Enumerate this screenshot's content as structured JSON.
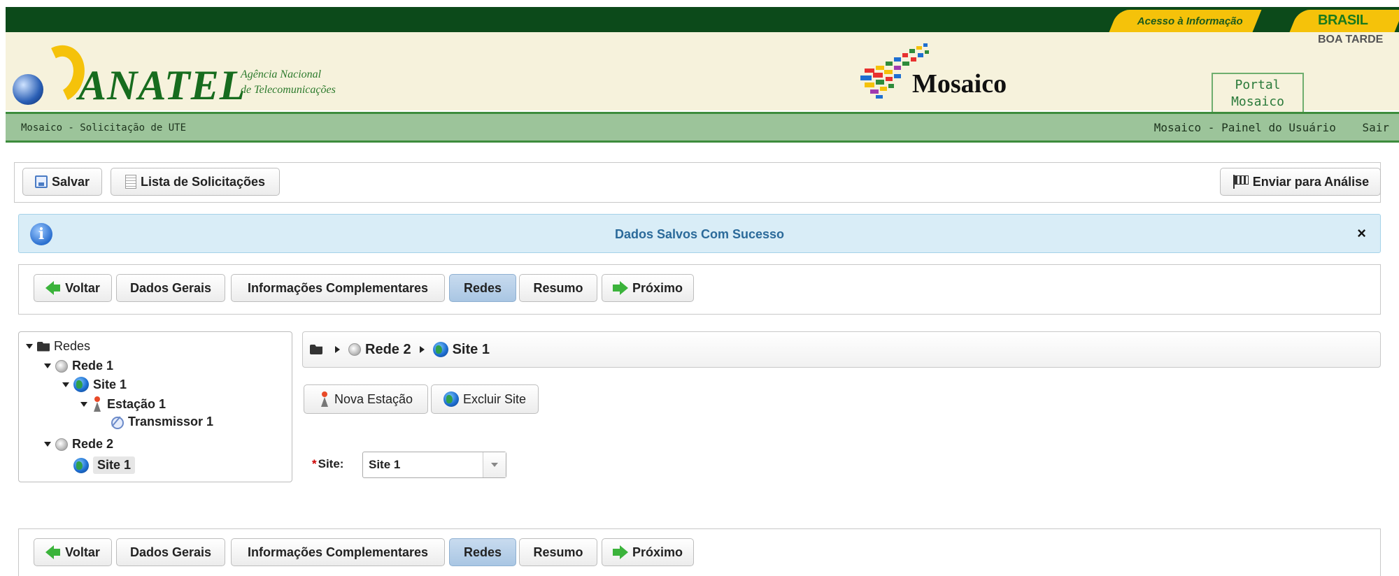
{
  "gov_bar": {
    "acesso_label": "Acesso à Informação",
    "brasil_label": "BRASIL"
  },
  "header": {
    "brand": "ANATEL",
    "brand_subtitle_line1": "Agência Nacional",
    "brand_subtitle_line2": "de Telecomunicações",
    "product": "Mosaico",
    "greeting": "BOA TARDE",
    "portal_line1": "Portal",
    "portal_line2": "Mosaico"
  },
  "nav": {
    "page_title": "Mosaico - Solicitação de UTE",
    "painel_label": "Mosaico - Painel do Usuário",
    "sair_label": "Sair"
  },
  "toolbar": {
    "save_label": "Salvar",
    "list_label": "Lista de Solicitações",
    "send_label": "Enviar para Análise"
  },
  "message": {
    "text": "Dados Salvos Com Sucesso",
    "close": "×",
    "icon_glyph": "i"
  },
  "wizard": {
    "back_label": "Voltar",
    "steps": [
      "Dados Gerais",
      "Informações Complementares",
      "Redes",
      "Resumo"
    ],
    "active_step": "Redes",
    "next_label": "Próximo"
  },
  "tree": {
    "root": "Redes",
    "rede1": "Rede 1",
    "rede1_site": "Site 1",
    "estacao": "Estação 1",
    "transmissor": "Transmissor 1",
    "rede2": "Rede 2",
    "rede2_site": "Site 1"
  },
  "breadcrumb": {
    "rede": "Rede 2",
    "site": "Site 1"
  },
  "site_actions": {
    "new_station": "Nova Estação",
    "delete_site": "Excluir Site"
  },
  "site_field": {
    "required_mark": "*",
    "label": "Site:",
    "value": "Site 1"
  },
  "colors": {
    "gov_green": "#0c4a1a",
    "accent_yellow": "#f5c20a",
    "nav_green": "#9cc49a",
    "info_bg": "#d9edf7",
    "active_step": "#a9c6e3"
  }
}
